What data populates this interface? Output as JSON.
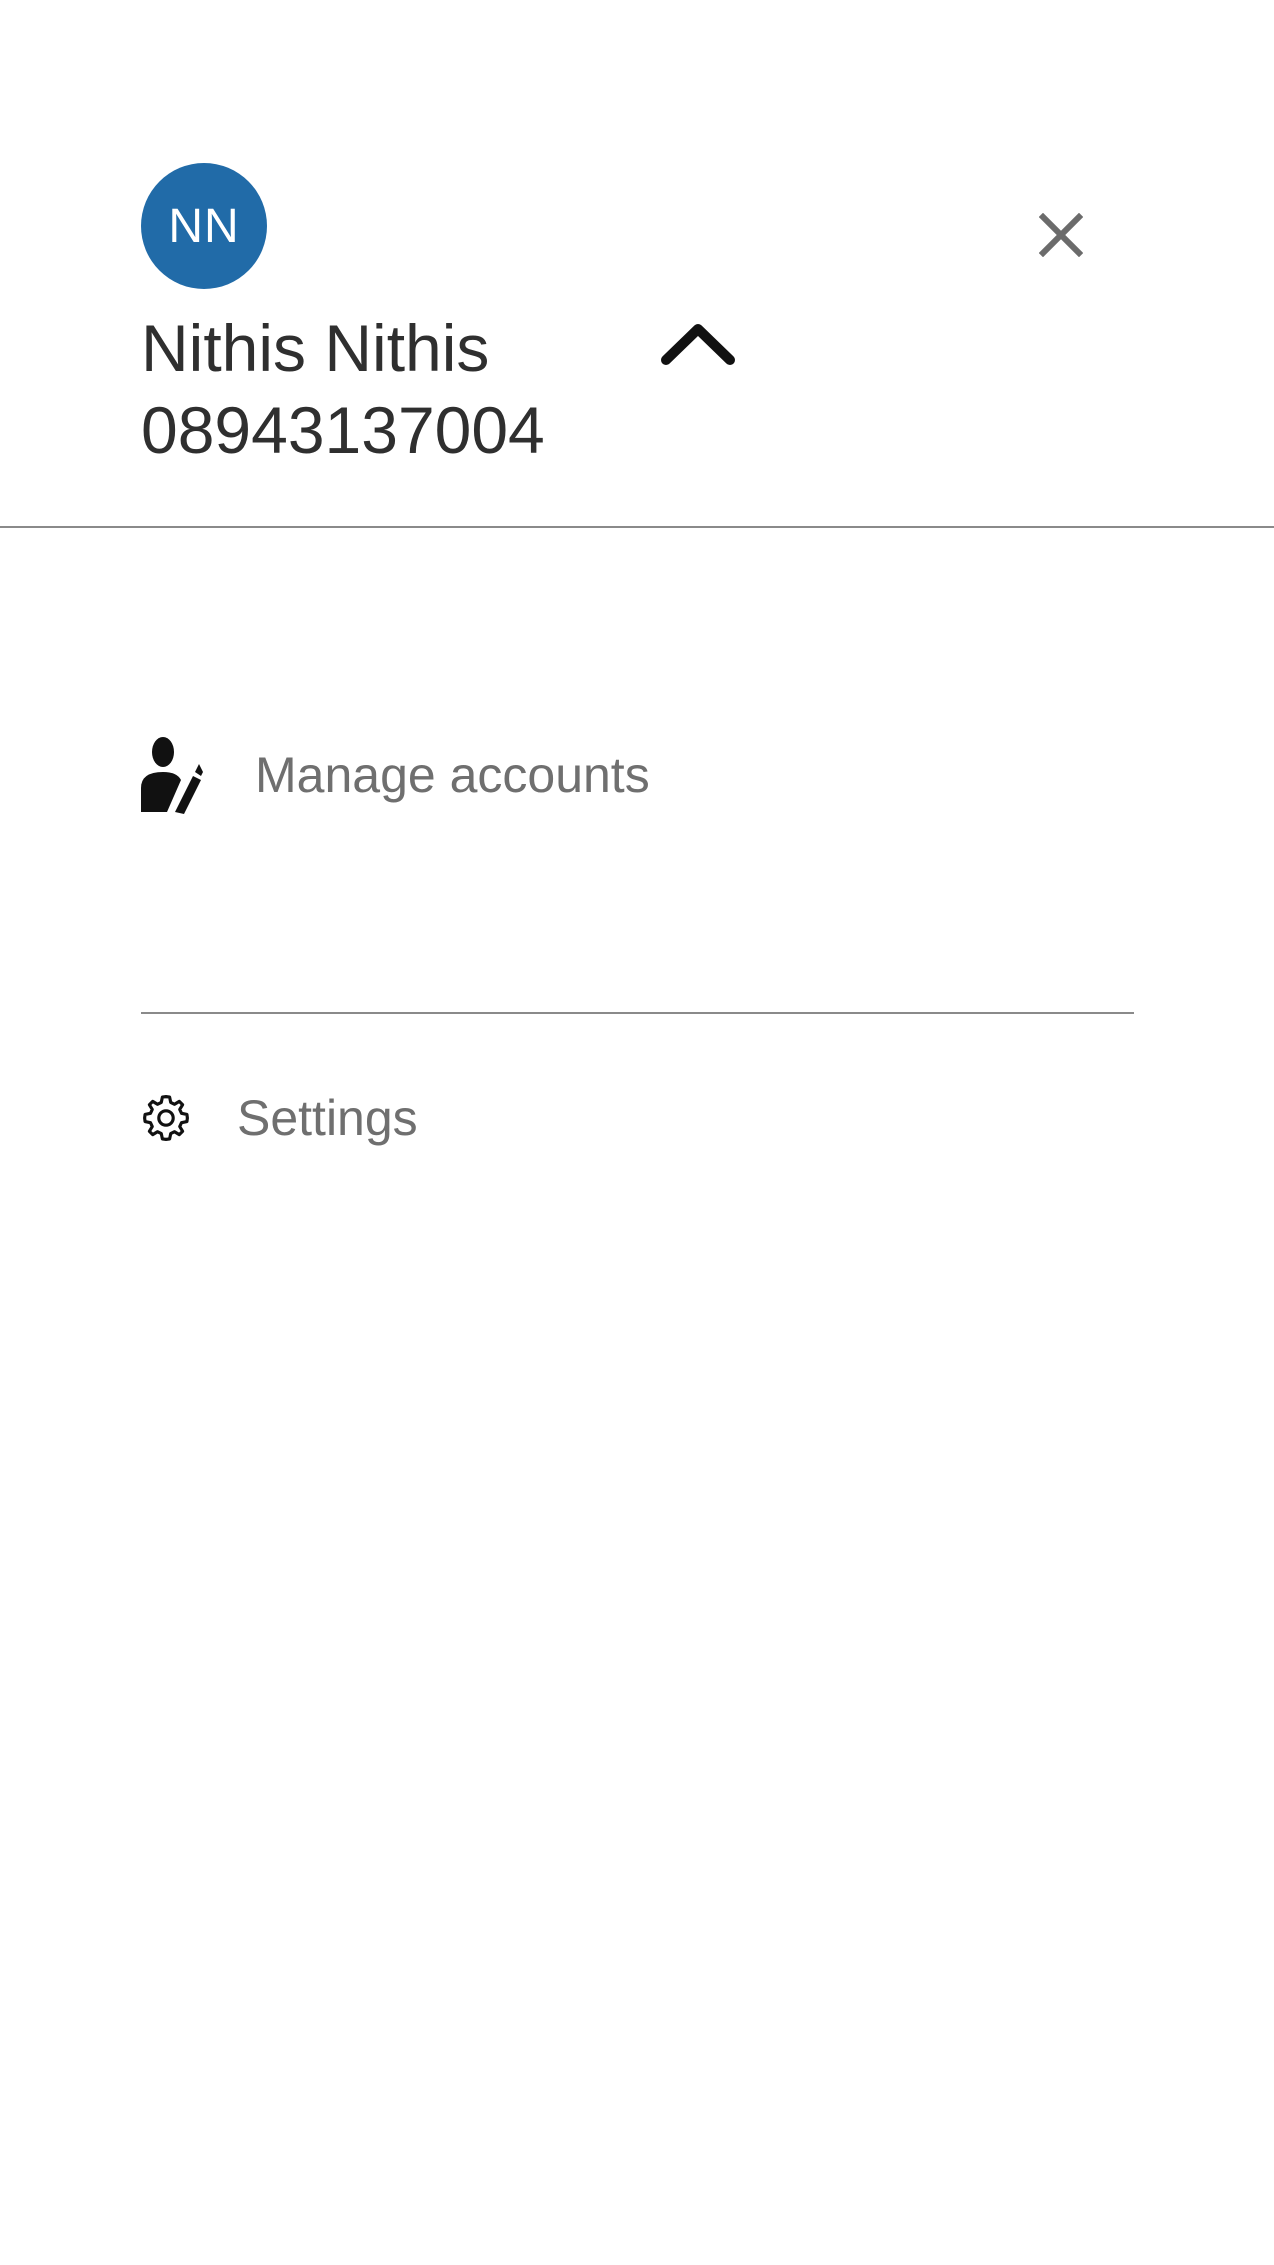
{
  "profile": {
    "initials": "NN",
    "name": "Nithis Nithis",
    "phone": "08943137004",
    "avatar_color": "#216ba8"
  },
  "header": {
    "close_icon": "close-icon",
    "toggle_icon": "chevron-up-icon"
  },
  "menu": {
    "items": [
      {
        "label": "Manage accounts",
        "icon": "manage-accounts-icon"
      },
      {
        "label": "Settings",
        "icon": "gear-icon"
      }
    ]
  },
  "colors": {
    "background": "#ffffff",
    "primary_text": "#2f2f2f",
    "secondary_text": "#6f6f6f",
    "divider": "#8a8a8a"
  }
}
